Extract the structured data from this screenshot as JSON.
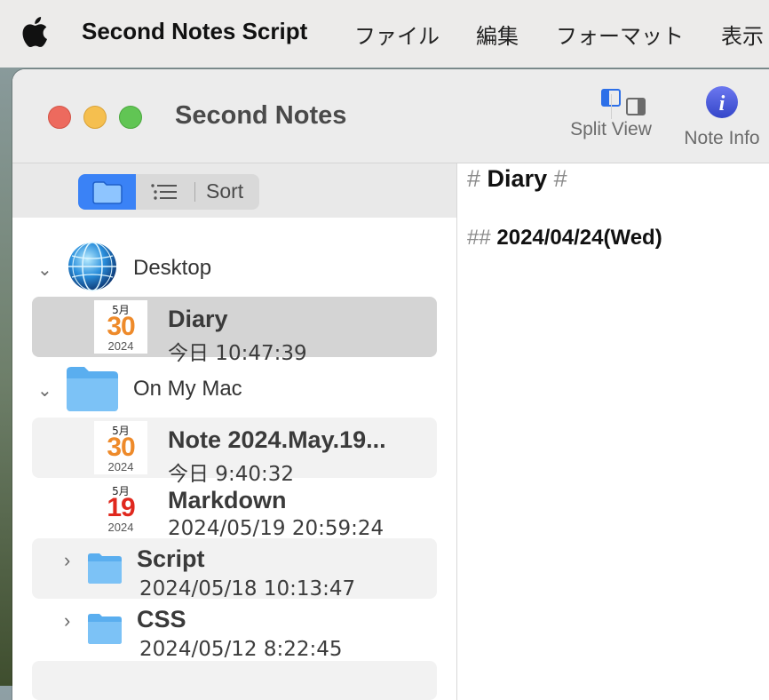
{
  "menubar": {
    "app_name": "Second Notes Script",
    "items": [
      "ファイル",
      "編集",
      "フォーマット",
      "表示"
    ]
  },
  "window": {
    "title": "Second Notes",
    "toolbar": {
      "split_view_label": "Split View",
      "note_info_label": "Note Info"
    }
  },
  "sidebar": {
    "toolbar": {
      "sort_label": "Sort"
    },
    "groups": [
      {
        "label": "Desktop",
        "icon": "globe-icon"
      },
      {
        "label": "On My Mac",
        "icon": "folder-icon"
      }
    ],
    "notes": [
      {
        "title": "Diary",
        "date": "今日 10:47:39",
        "cal_month": "5月",
        "cal_day": "30",
        "cal_year": "2024"
      },
      {
        "title": "Note 2024.May.19...",
        "date": "今日 9:40:32",
        "cal_month": "5月",
        "cal_day": "30",
        "cal_year": "2024"
      },
      {
        "title": "Markdown",
        "date": "2024/05/19 20:59:24",
        "cal_month": "5月",
        "cal_day": "19",
        "cal_year": "2024"
      }
    ],
    "folders": [
      {
        "title": "Script",
        "date": "2024/05/18 10:13:47"
      },
      {
        "title": "CSS",
        "date": "2024/05/12 8:22:45"
      }
    ]
  },
  "editor": {
    "h1_prefix": "#",
    "h1_text": "Diary",
    "h1_suffix": "#",
    "h2_prefix": "##",
    "h2_text": "2024/04/24(Wed)"
  },
  "colors": {
    "accent": "#3a82f6",
    "calendar_orange": "#ee8a2a",
    "calendar_red": "#e0281e",
    "selection": "#d4d4d4"
  }
}
